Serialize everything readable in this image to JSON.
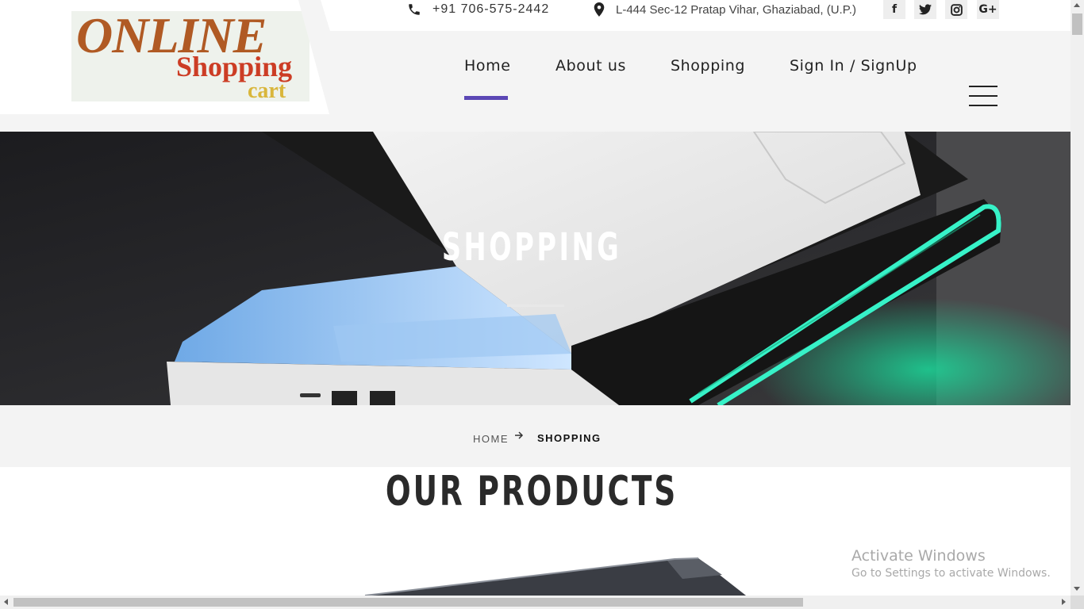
{
  "logo": {
    "line1": "ONLINE",
    "line2": "Shopping",
    "line3": "cart"
  },
  "topbar": {
    "phone": "+91 706-575-2442",
    "address": "L-444 Sec-12 Pratap Vihar, Ghaziabad, (U.P.)",
    "social": [
      {
        "glyph": "f",
        "icon": "facebook-icon"
      },
      {
        "glyph": "t",
        "icon": "twitter-icon"
      },
      {
        "glyph": "",
        "icon": "instagram-icon"
      },
      {
        "glyph": "G+",
        "icon": "google-plus-icon"
      }
    ]
  },
  "nav": {
    "items": [
      "Home",
      "About us",
      "Shopping",
      "Sign In / SignUp"
    ],
    "active": "Home",
    "accent": "#5b47b5"
  },
  "hero": {
    "title": "SHOPPING"
  },
  "breadcrumb": {
    "home": "HOME",
    "current": "SHOPPING",
    "separator_icon": "arrow-right-icon"
  },
  "products": {
    "title": "OUR PRODUCTS"
  },
  "watermark": {
    "title": "Activate Windows",
    "subtitle": "Go to Settings to activate Windows."
  }
}
